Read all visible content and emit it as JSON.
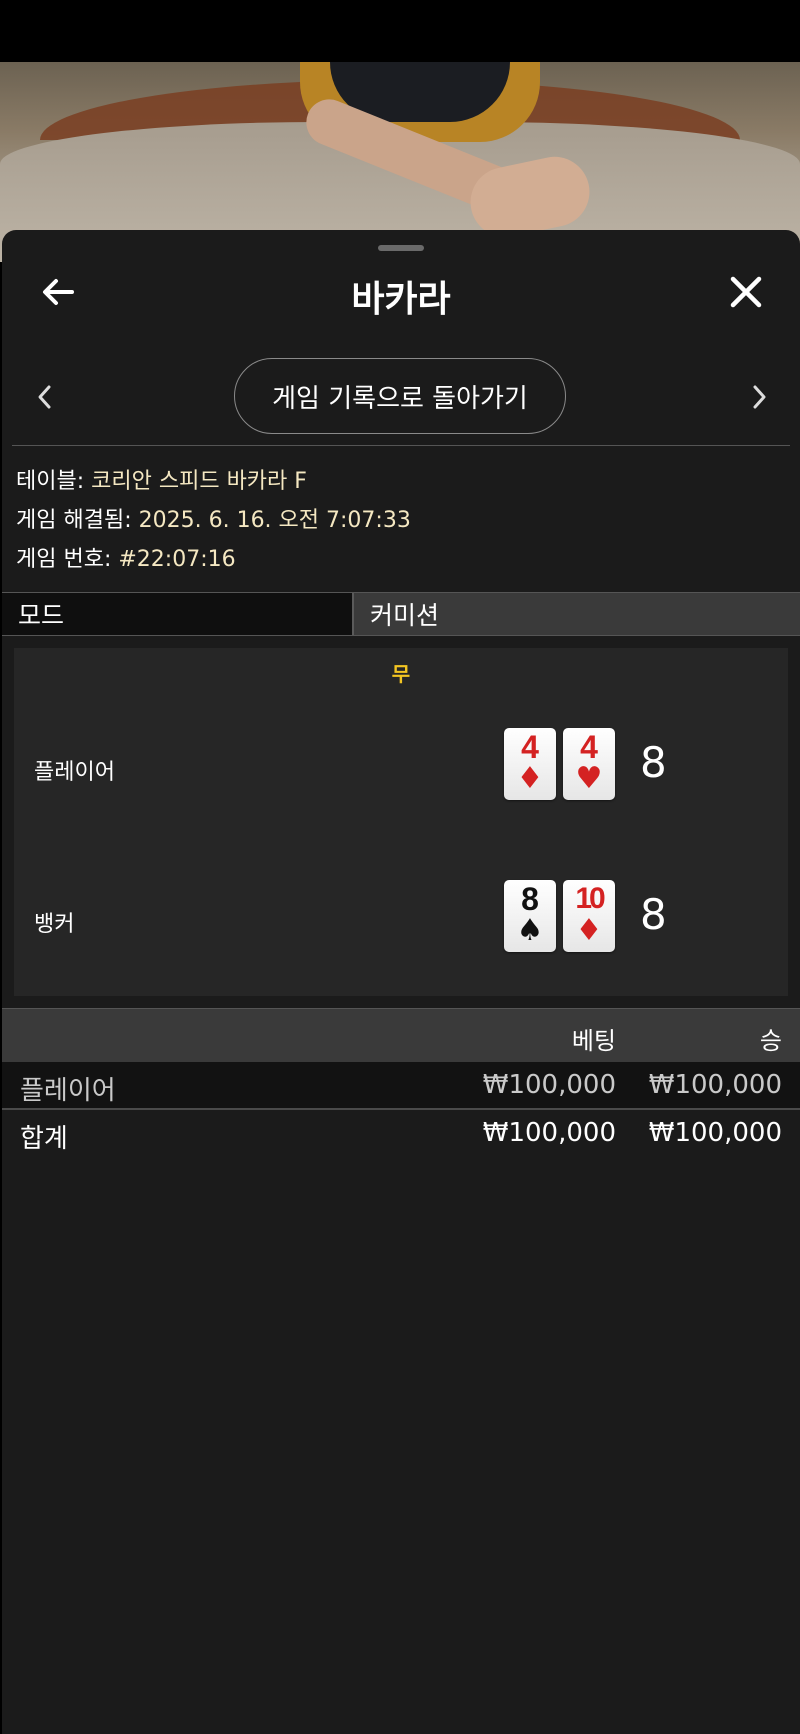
{
  "header": {
    "title": "바카라",
    "back_icon": "arrow-left-icon",
    "close_icon": "close-icon"
  },
  "nav": {
    "history_button": "게임 기록으로 돌아가기",
    "prev_icon": "chevron-left-icon",
    "next_icon": "chevron-right-icon"
  },
  "info": {
    "table_label": "테이블: ",
    "table_value": "코리안 스피드 바카라 F",
    "resolved_label": "게임 해결됨: ",
    "resolved_value": "2025. 6. 16. 오전 7:07:33",
    "number_label": "게임 번호: ",
    "number_value": "#22:07:16"
  },
  "tabs": {
    "mode": "모드",
    "commission": "커미션"
  },
  "result": {
    "outcome": "무",
    "player": {
      "name": "플레이어",
      "cards": [
        {
          "rank": "4",
          "suit": "♦",
          "color": "red"
        },
        {
          "rank": "4",
          "suit": "♥",
          "color": "red"
        }
      ],
      "score": "8"
    },
    "banker": {
      "name": "뱅커",
      "cards": [
        {
          "rank": "8",
          "suit": "♠",
          "color": "black"
        },
        {
          "rank": "10",
          "suit": "♦",
          "color": "red"
        }
      ],
      "score": "8"
    }
  },
  "bets": {
    "header_bet": "베팅",
    "header_win": "승",
    "rows": [
      {
        "name": "플레이어",
        "bet": "₩100,000",
        "win": "₩100,000"
      }
    ],
    "total": {
      "name": "합계",
      "bet": "₩100,000",
      "win": "₩100,000"
    }
  },
  "colors": {
    "accent_yellow": "#f3c522",
    "info_value": "#f5e8c2",
    "card_red": "#d42222"
  }
}
